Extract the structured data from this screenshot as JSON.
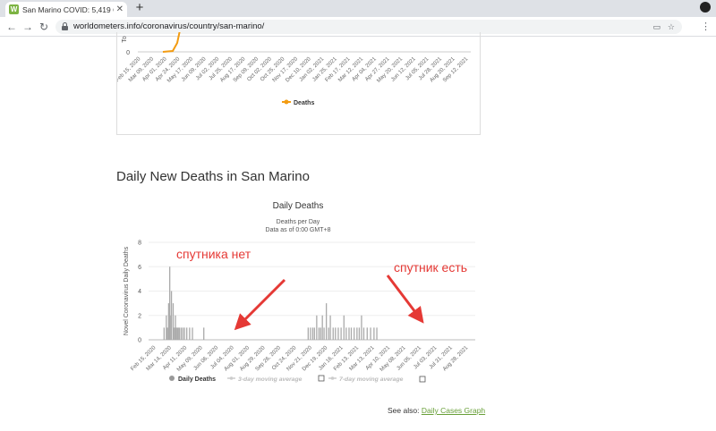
{
  "browser": {
    "tab_title": "San Marino COVID: 5,419 Cases a",
    "tab_favicon": "W",
    "url": "worldometers.info/coronavirus/country/san-marino/"
  },
  "top_chart": {
    "ylabel": "To",
    "zero_tick": "0",
    "x_ticks": [
      "Feb 15, 2020",
      "Mar 09, 2020",
      "Apr 01, 2020",
      "Apr 24, 2020",
      "May 17, 2020",
      "Jun 09, 2020",
      "Jul 02, 2020",
      "Jul 25, 2020",
      "Aug 17, 2020",
      "Sep 09, 2020",
      "Oct 02, 2020",
      "Oct 25, 2020",
      "Nov 17, 2020",
      "Dec 10, 2020",
      "Jan 02, 2021",
      "Jan 25, 2021",
      "Feb 17, 2021",
      "Mar 12, 2021",
      "Apr 04, 2021",
      "Apr 27, 2021",
      "May 20, 2021",
      "Jun 12, 2021",
      "Jul 05, 2021",
      "Jul 28, 2021",
      "Aug 20, 2021",
      "Sep 12, 2021"
    ],
    "legend": "Deaths",
    "color": "#f39c12"
  },
  "section_title": "Daily New Deaths in San Marino",
  "chart_data": {
    "type": "bar",
    "title": "Daily Deaths",
    "subtitle_1": "Deaths per Day",
    "subtitle_2": "Data as of 0:00 GMT+8",
    "ylabel": "Novel Coronavirus Daily Deaths",
    "ylim": [
      0,
      8
    ],
    "y_ticks": [
      "0",
      "2",
      "4",
      "6",
      "8"
    ],
    "x_ticks": [
      "Feb 15, 2020",
      "Mar 14, 2020",
      "Apr 11, 2020",
      "May 09, 2020",
      "Jun 06, 2020",
      "Jul 04, 2020",
      "Aug 01, 2020",
      "Aug 29, 2020",
      "Sep 26, 2020",
      "Oct 24, 2020",
      "Nov 21, 2020",
      "Dec 19, 2020",
      "Jan 16, 2021",
      "Feb 13, 2021",
      "Mar 13, 2021",
      "Apr 10, 2021",
      "May 08, 2021",
      "Jun 05, 2021",
      "Jul 03, 2021",
      "Jul 31, 2021",
      "Aug 28, 2021"
    ],
    "bars": [
      {
        "day": 20,
        "value": 1
      },
      {
        "day": 24,
        "value": 2
      },
      {
        "day": 26,
        "value": 1
      },
      {
        "day": 28,
        "value": 3
      },
      {
        "day": 30,
        "value": 6
      },
      {
        "day": 32,
        "value": 2
      },
      {
        "day": 33,
        "value": 4
      },
      {
        "day": 36,
        "value": 3
      },
      {
        "day": 38,
        "value": 1
      },
      {
        "day": 40,
        "value": 2
      },
      {
        "day": 41,
        "value": 1
      },
      {
        "day": 43,
        "value": 1
      },
      {
        "day": 45,
        "value": 1
      },
      {
        "day": 47,
        "value": 1
      },
      {
        "day": 50,
        "value": 1
      },
      {
        "day": 53,
        "value": 1
      },
      {
        "day": 56,
        "value": 1
      },
      {
        "day": 60,
        "value": 1
      },
      {
        "day": 65,
        "value": 1
      },
      {
        "day": 70,
        "value": 1
      },
      {
        "day": 90,
        "value": 1
      },
      {
        "day": 274,
        "value": 1
      },
      {
        "day": 278,
        "value": 1
      },
      {
        "day": 282,
        "value": 1
      },
      {
        "day": 285,
        "value": 1
      },
      {
        "day": 289,
        "value": 2
      },
      {
        "day": 293,
        "value": 1
      },
      {
        "day": 296,
        "value": 1
      },
      {
        "day": 299,
        "value": 2
      },
      {
        "day": 302,
        "value": 1
      },
      {
        "day": 306,
        "value": 3
      },
      {
        "day": 310,
        "value": 1
      },
      {
        "day": 313,
        "value": 2
      },
      {
        "day": 318,
        "value": 1
      },
      {
        "day": 322,
        "value": 1
      },
      {
        "day": 327,
        "value": 1
      },
      {
        "day": 332,
        "value": 1
      },
      {
        "day": 337,
        "value": 2
      },
      {
        "day": 341,
        "value": 1
      },
      {
        "day": 346,
        "value": 1
      },
      {
        "day": 350,
        "value": 1
      },
      {
        "day": 355,
        "value": 1
      },
      {
        "day": 360,
        "value": 1
      },
      {
        "day": 364,
        "value": 1
      },
      {
        "day": 368,
        "value": 2
      },
      {
        "day": 372,
        "value": 1
      },
      {
        "day": 378,
        "value": 1
      },
      {
        "day": 384,
        "value": 1
      },
      {
        "day": 390,
        "value": 1
      },
      {
        "day": 395,
        "value": 1
      }
    ],
    "x_days_total": 560,
    "legend": [
      "Daily Deaths",
      "3-day moving average",
      "7-day moving average"
    ]
  },
  "annotations": {
    "left": "спутника нет",
    "right": "спутник есть"
  },
  "see_also": {
    "label": "See also:",
    "link": "Daily Cases Graph"
  }
}
